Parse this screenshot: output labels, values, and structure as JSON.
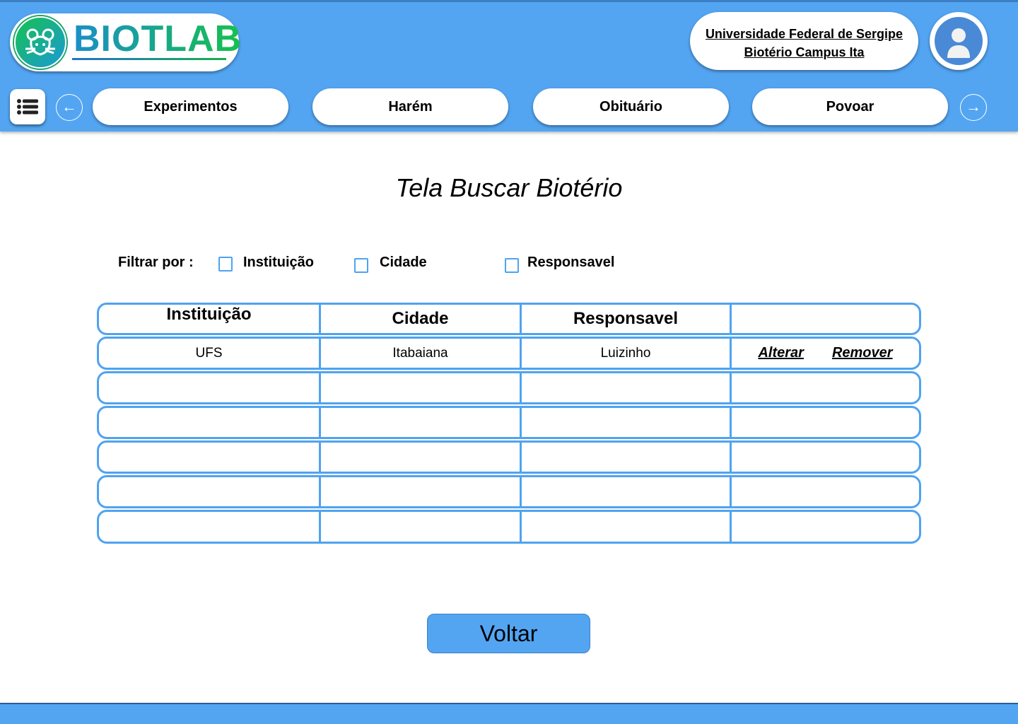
{
  "header": {
    "logo_text": "BIOTLAB",
    "university": "Universidade Federal de Sergipe",
    "campus": "Biotério Campus Ita"
  },
  "nav": {
    "items": [
      "Experimentos",
      "Harém",
      "Obituário",
      "Povoar"
    ]
  },
  "page": {
    "title": "Tela Buscar Biotério"
  },
  "filter": {
    "label": "Filtrar por :",
    "options": [
      "Instituição",
      "Cidade",
      "Responsavel"
    ]
  },
  "table": {
    "headers": [
      "Instituição",
      "Cidade",
      "Responsavel",
      ""
    ],
    "rows": [
      {
        "instituicao": "UFS",
        "cidade": "Itabaiana",
        "responsavel": "Luizinho",
        "alterar": "Alterar",
        "remover": "Remover"
      }
    ]
  },
  "actions": {
    "back": "Voltar"
  },
  "colors": {
    "primary": "#53a5f2",
    "border": "#4fa3f0"
  }
}
